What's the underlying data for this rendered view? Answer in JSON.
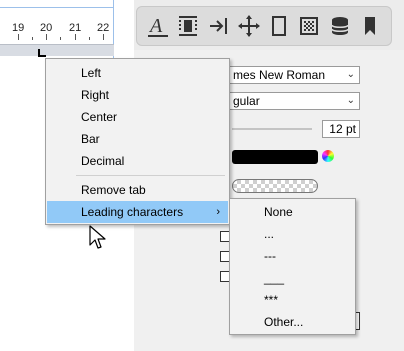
{
  "ruler": {
    "numbers": [
      "19",
      "20",
      "21",
      "22"
    ]
  },
  "toolbar": {
    "icons": [
      "text-style-icon",
      "vertical-align-icon",
      "indent-arrow-icon",
      "move-icon",
      "page-icon",
      "pattern-icon",
      "database-icon",
      "bookmark-icon"
    ]
  },
  "panel": {
    "font_value": "mes New Roman",
    "style_value": "gular",
    "size_value": "12 pt",
    "text_color": "#000000"
  },
  "context_menu": {
    "items": [
      "Left",
      "Right",
      "Center",
      "Bar",
      "Decimal",
      "Remove tab",
      "Leading characters"
    ],
    "submenu_arrow": "›"
  },
  "submenu": {
    "items": [
      "None",
      "...",
      "---",
      "___",
      "***",
      "Other..."
    ]
  },
  "colors": {
    "highlight": "#91c9f7",
    "menu_bg": "#f2f2f2",
    "panel_bg": "#ececec"
  }
}
